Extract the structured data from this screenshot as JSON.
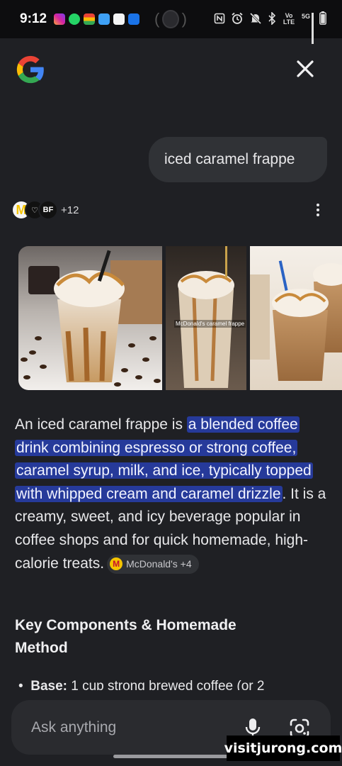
{
  "status_bar": {
    "time": "9:12",
    "network_label": "5G",
    "volte_label": "Vo LTE"
  },
  "header": {
    "logo_icon": "google-g-logo",
    "close_icon": "close-icon"
  },
  "query": {
    "text": "iced caramel frappe"
  },
  "sources": {
    "more_count": "+12"
  },
  "images": [
    {
      "name": "caramel-frappe-coffee-beans"
    },
    {
      "name": "mcdonalds-caramel-frappe",
      "caption": "McDonald's caramel frappe"
    },
    {
      "name": "caramel-frappe-glasses-straws"
    }
  ],
  "answer": {
    "intro": "An iced caramel frappe is ",
    "highlight": "a blended coffee drink combining espresso or strong coffee, caramel syrup, milk, and ice, typically topped with whipped cream and caramel drizzle",
    "rest": ". It is a creamy, sweet, and icy beverage popular in coffee shops and for quick homemade, high-calorie treats.",
    "citation_label": "McDonald's +4"
  },
  "section": {
    "title": "Key Components & Homemade Method",
    "bullet_bold": "Base:",
    "bullet_text": " 1 cup strong brewed coffee (or 2"
  },
  "input": {
    "placeholder": "Ask anything"
  },
  "watermark": "visitjurong.com",
  "colors": {
    "background": "#1f2024",
    "highlight": "#263a9a",
    "bubble": "#303236",
    "input": "#2a2b2f"
  }
}
